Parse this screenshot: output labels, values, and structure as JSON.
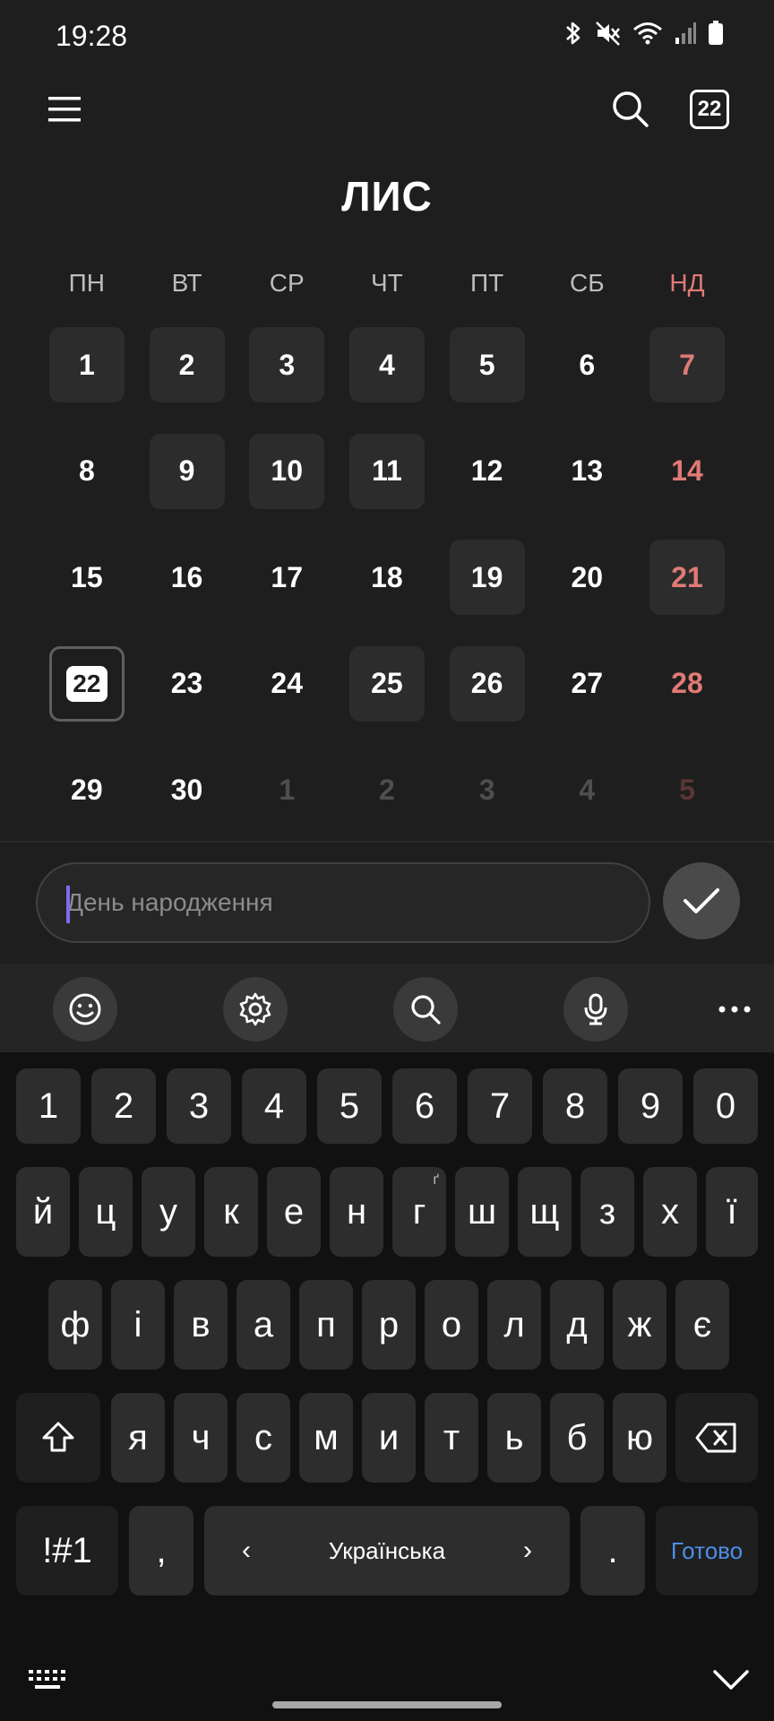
{
  "status": {
    "time": "19:28"
  },
  "header": {
    "month_title": "ЛИС",
    "today_badge": "22"
  },
  "calendar": {
    "weekdays": [
      "ПН",
      "ВТ",
      "СР",
      "ЧТ",
      "ПТ",
      "СБ",
      "НД"
    ],
    "weeks": [
      [
        "1",
        "2",
        "3",
        "4",
        "5",
        "6",
        "7"
      ],
      [
        "8",
        "9",
        "10",
        "11",
        "12",
        "13",
        "14"
      ],
      [
        "15",
        "16",
        "17",
        "18",
        "19",
        "20",
        "21"
      ],
      [
        "22",
        "23",
        "24",
        "25",
        "26",
        "27",
        "28"
      ],
      [
        "29",
        "30",
        "1",
        "2",
        "3",
        "4",
        "5"
      ]
    ],
    "today": "22"
  },
  "event_input": {
    "placeholder": "День народження",
    "value": ""
  },
  "keyboard": {
    "numbers": [
      "1",
      "2",
      "3",
      "4",
      "5",
      "6",
      "7",
      "8",
      "9",
      "0"
    ],
    "row1": [
      "й",
      "ц",
      "у",
      "к",
      "е",
      "н",
      "г",
      "ш",
      "щ",
      "з",
      "х",
      "ї"
    ],
    "row1_hint_g": "ґ",
    "row2": [
      "ф",
      "і",
      "в",
      "а",
      "п",
      "р",
      "о",
      "л",
      "д",
      "ж",
      "є"
    ],
    "row3": [
      "я",
      "ч",
      "с",
      "м",
      "и",
      "т",
      "ь",
      "б",
      "ю"
    ],
    "symbols_label": "!#1",
    "comma_label": ",",
    "space_label": "Українська",
    "space_left_arrow": "‹",
    "space_right_arrow": "›",
    "period_label": ".",
    "done_label": "Готово"
  },
  "colors": {
    "background": "#1e1e1e",
    "sunday": "#e07a76",
    "caret": "#7c6cf0",
    "done": "#4d8ee8"
  }
}
